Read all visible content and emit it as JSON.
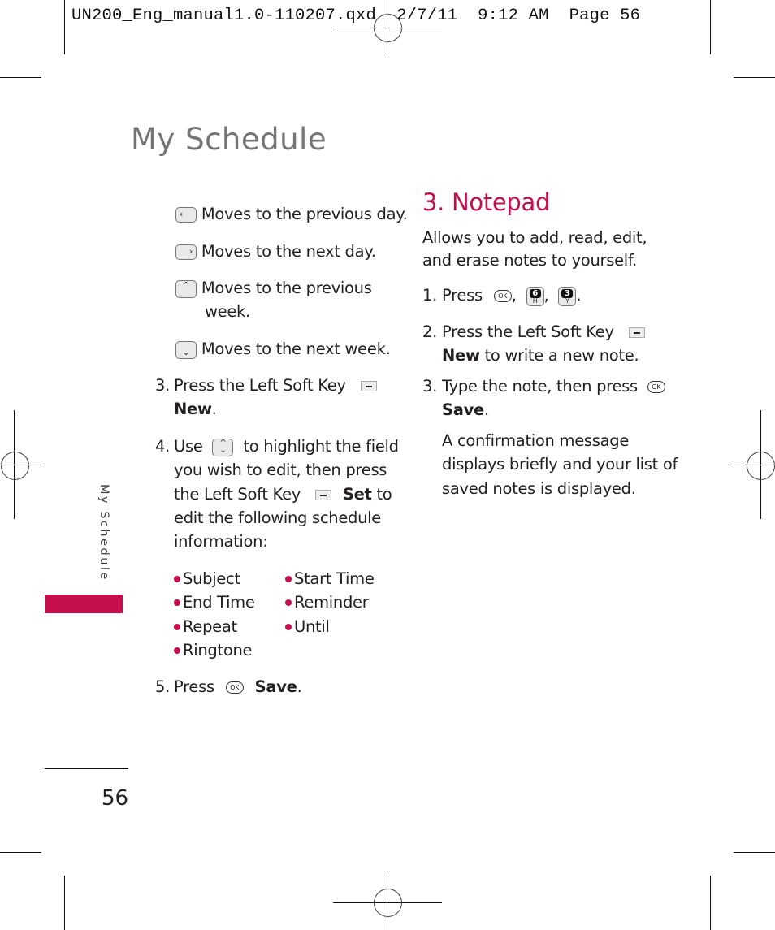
{
  "slug": "UN200_Eng_manual1.0-110207.qxd  2/7/11  9:12 AM  Page 56",
  "page_title": "My Schedule",
  "side_tab_label": "My Schedule",
  "page_number": "56",
  "accent_color": "#c50f4a",
  "left_column": {
    "key_descriptions": [
      {
        "icon": "left-arrow-key-icon",
        "glyph": "‹",
        "text": "Moves to the previous day."
      },
      {
        "icon": "right-arrow-key-icon",
        "glyph": "›",
        "text": "Moves to the next day."
      },
      {
        "icon": "up-arrow-key-icon",
        "glyph": "^",
        "text": "Moves to the previous",
        "text2": "week."
      },
      {
        "icon": "down-arrow-key-icon",
        "glyph": "⌄",
        "text": "Moves to the next week."
      }
    ],
    "step3": {
      "num": "3.",
      "text": "Press the Left Soft Key",
      "bold": "New",
      "after": "."
    },
    "step4": {
      "num": "4.",
      "line1a": "Use",
      "line1b": "to highlight the field",
      "line2": "you wish to edit, then press",
      "line3a": "the Left Soft Key",
      "line3bold": "Set",
      "line3b": "to",
      "line4": "edit the following schedule",
      "line5": "information:"
    },
    "fields": [
      "Subject",
      "Start Time",
      "End Time",
      "Reminder",
      "Repeat",
      "Until",
      "Ringtone"
    ],
    "step5": {
      "num": "5.",
      "text": "Press",
      "ok": "OK",
      "bold": "Save",
      "after": "."
    }
  },
  "right_column": {
    "heading": "3. Notepad",
    "intro1": "Allows you to add, read, edit,",
    "intro2": "and erase notes to yourself.",
    "step1": {
      "num": "1.",
      "text": "Press",
      "ok": "OK",
      "key6_top": "6",
      "key6_bot": "H",
      "key3_top": "3",
      "key3_bot": "Y",
      "comma": ",",
      "period": "."
    },
    "step2": {
      "num": "2.",
      "text": "Press the Left Soft Key",
      "bold": "New",
      "after": "to write a new note."
    },
    "step3": {
      "num": "3.",
      "text": "Type the note, then press",
      "ok": "OK",
      "bold": "Save",
      "after": "."
    },
    "confirmation": [
      "A confirmation message",
      "displays briefly and your list of",
      "saved notes is displayed."
    ]
  }
}
